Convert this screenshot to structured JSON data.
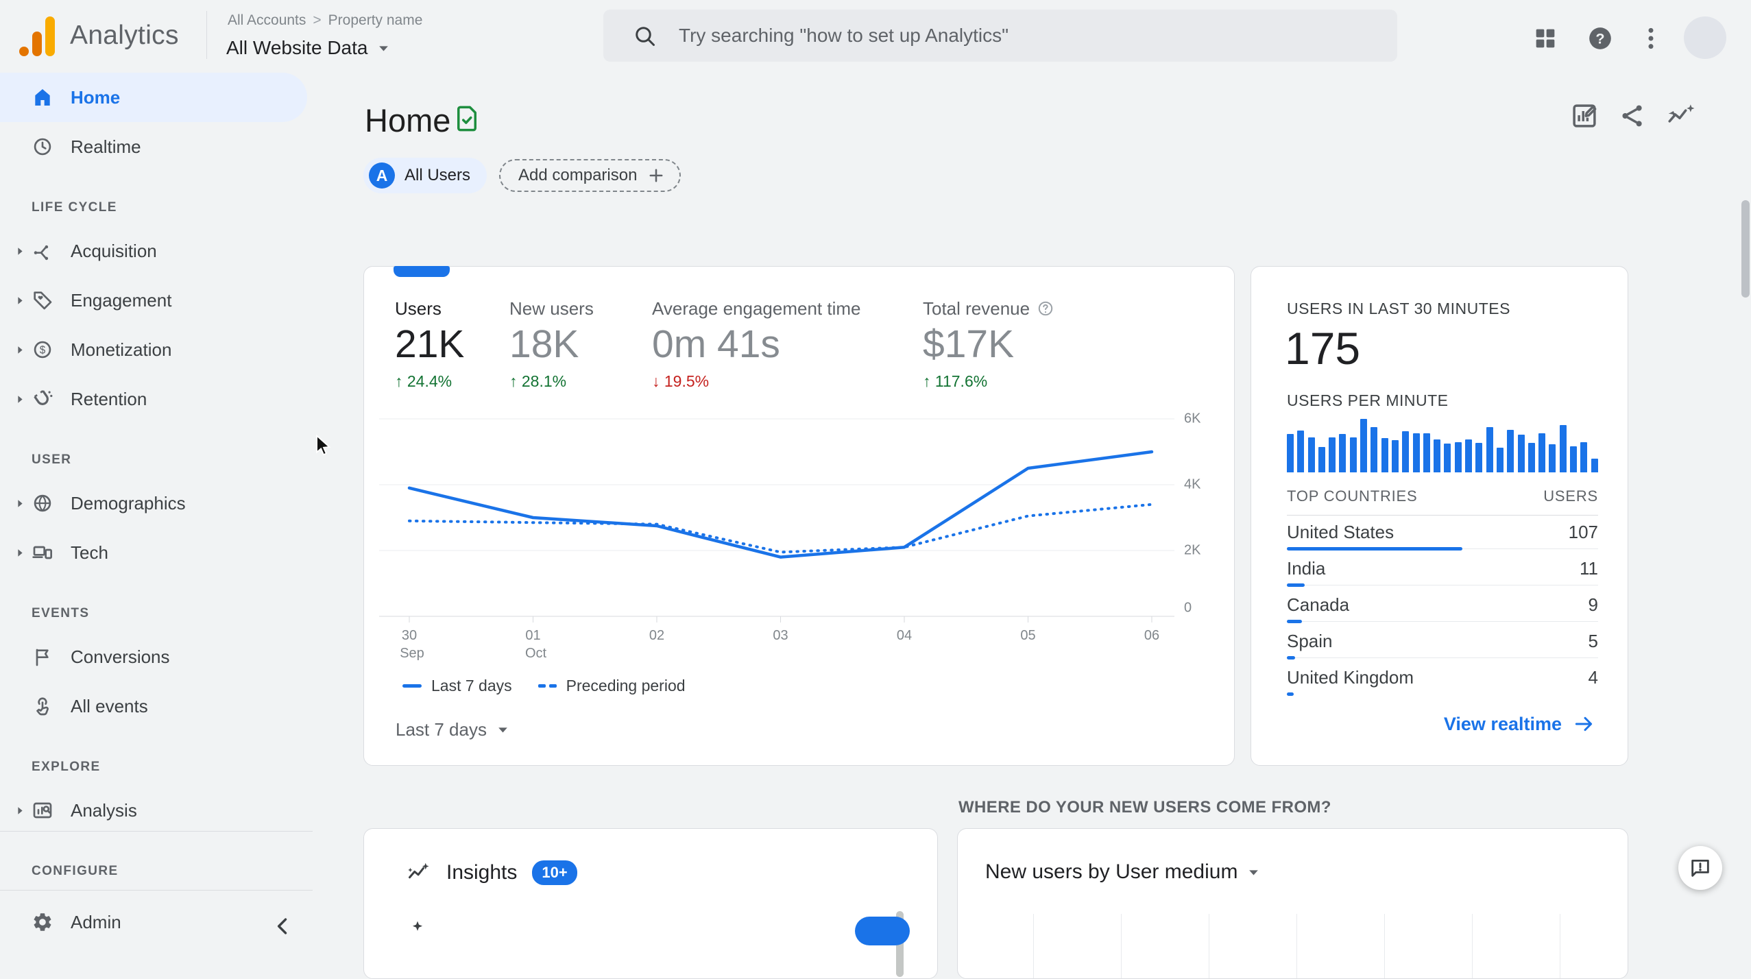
{
  "header": {
    "app_name": "Analytics",
    "breadcrumb": {
      "items": [
        "All Accounts",
        "Property name"
      ],
      "separator": ">"
    },
    "property_selector": "All Website Data",
    "search": {
      "placeholder": "Try searching \"how to set up Analytics\""
    }
  },
  "sidebar": {
    "sections": [
      {
        "label": "",
        "items": [
          {
            "label": "Home",
            "icon": "home",
            "selected": true,
            "expandable": false
          },
          {
            "label": "Realtime",
            "icon": "clock",
            "selected": false,
            "expandable": false
          }
        ]
      },
      {
        "label": "LIFE CYCLE",
        "items": [
          {
            "label": "Acquisition",
            "icon": "acquisition",
            "expandable": true
          },
          {
            "label": "Engagement",
            "icon": "engagement",
            "expandable": true
          },
          {
            "label": "Monetization",
            "icon": "monetization",
            "expandable": true
          },
          {
            "label": "Retention",
            "icon": "retention",
            "expandable": true
          }
        ]
      },
      {
        "label": "USER",
        "items": [
          {
            "label": "Demographics",
            "icon": "demographics",
            "expandable": true
          },
          {
            "label": "Tech",
            "icon": "tech",
            "expandable": true
          }
        ]
      },
      {
        "label": "EVENTS",
        "items": [
          {
            "label": "Conversions",
            "icon": "conversions",
            "expandable": false
          },
          {
            "label": "All events",
            "icon": "allevents",
            "expandable": false
          }
        ]
      },
      {
        "label": "EXPLORE",
        "items": [
          {
            "label": "Analysis",
            "icon": "analysis",
            "expandable": true
          }
        ]
      },
      {
        "label": "CONFIGURE",
        "divider_after_label": true,
        "items": [
          {
            "label": "Admin",
            "icon": "admin",
            "expandable": false
          }
        ]
      }
    ]
  },
  "page": {
    "title": "Home",
    "all_users_chip": {
      "badge": "A",
      "label": "All Users"
    },
    "add_comparison_label": "Add comparison"
  },
  "overview": {
    "metrics": [
      {
        "label": "Users",
        "value": "21K",
        "arrow": "↑",
        "delta": "24.4%",
        "direction": "up",
        "primary": true
      },
      {
        "label": "New users",
        "value": "18K",
        "arrow": "↑",
        "delta": "28.1%",
        "direction": "up"
      },
      {
        "label": "Average engagement time",
        "value": "0m 41s",
        "arrow": "↓",
        "delta": "19.5%",
        "direction": "down"
      },
      {
        "label": "Total revenue",
        "value": "$17K",
        "arrow": "↑",
        "delta": "117.6%",
        "direction": "up",
        "help_icon": true
      }
    ],
    "y_axis": [
      {
        "value": 6000,
        "label": "6K"
      },
      {
        "value": 4000,
        "label": "4K"
      },
      {
        "value": 2000,
        "label": "2K"
      },
      {
        "value": 0,
        "label": "0"
      }
    ],
    "x_axis": [
      {
        "label": "30",
        "sub": "Sep"
      },
      {
        "label": "01",
        "sub": "Oct"
      },
      {
        "label": "02"
      },
      {
        "label": "03"
      },
      {
        "label": "04"
      },
      {
        "label": "05"
      },
      {
        "label": "06"
      }
    ],
    "legend": [
      {
        "label": "Last 7 days",
        "style": "solid"
      },
      {
        "label": "Preceding period",
        "style": "dashed"
      }
    ],
    "range_label": "Last 7 days"
  },
  "realtime": {
    "title": "USERS IN LAST 30 MINUTES",
    "value": "175",
    "per_minute_label": "USERS PER MINUTE",
    "countries": {
      "name_header": "TOP COUNTRIES",
      "users_header": "USERS",
      "bar_scale_max": 190
    },
    "link_label": "View realtime"
  },
  "insights": {
    "title": "Insights",
    "badge": "10+"
  },
  "new_users": {
    "heading": "WHERE DO YOUR NEW USERS COME FROM?",
    "selector": "New users by User medium"
  },
  "colors": {
    "accent": "#1a73e8",
    "positive": "#137333",
    "negative": "#c5221f",
    "logo_orange": "#e37400",
    "logo_yellow": "#f9ab00",
    "doc_check_green": "#1e8e3e"
  },
  "chart_data": [
    {
      "type": "line",
      "title": "Users: Last 7 days vs Preceding period",
      "x": [
        "30 Sep",
        "01 Oct",
        "02 Oct",
        "03 Oct",
        "04 Oct",
        "05 Oct",
        "06 Oct"
      ],
      "series": [
        {
          "name": "Last 7 days",
          "style": "solid",
          "values": [
            3900,
            3000,
            2750,
            1800,
            2100,
            4500,
            5000
          ]
        },
        {
          "name": "Preceding period",
          "style": "dashed",
          "values": [
            2900,
            2850,
            2800,
            1950,
            2100,
            3050,
            3400
          ]
        }
      ],
      "ylim": [
        0,
        6000
      ],
      "yticks": [
        "0",
        "2K",
        "4K",
        "6K"
      ],
      "grid": true,
      "legend_position": "bottom"
    },
    {
      "type": "bar",
      "title": "Users per minute (last 30 minutes)",
      "categories_note": "30 one-minute buckets, oldest to newest",
      "values_est_users": [
        6,
        7,
        6,
        4,
        6,
        6,
        6,
        9,
        8,
        6,
        5,
        7,
        7,
        7,
        6,
        5,
        5,
        5,
        5,
        8,
        4,
        7,
        6,
        5,
        7,
        5,
        8,
        4,
        5,
        2
      ],
      "heights_pct": [
        72,
        78,
        66,
        47,
        66,
        72,
        66,
        100,
        85,
        64,
        60,
        77,
        73,
        73,
        62,
        54,
        57,
        61,
        55,
        84,
        46,
        80,
        70,
        55,
        73,
        53,
        89,
        49,
        56,
        26
      ]
    },
    {
      "type": "table",
      "title": "Top countries by users (last 30 minutes)",
      "columns": [
        "TOP COUNTRIES",
        "USERS"
      ],
      "rows": [
        {
          "country": "United States",
          "users": 107
        },
        {
          "country": "India",
          "users": 11
        },
        {
          "country": "Canada",
          "users": 9
        },
        {
          "country": "Spain",
          "users": 5
        },
        {
          "country": "United Kingdom",
          "users": 4
        }
      ]
    }
  ]
}
